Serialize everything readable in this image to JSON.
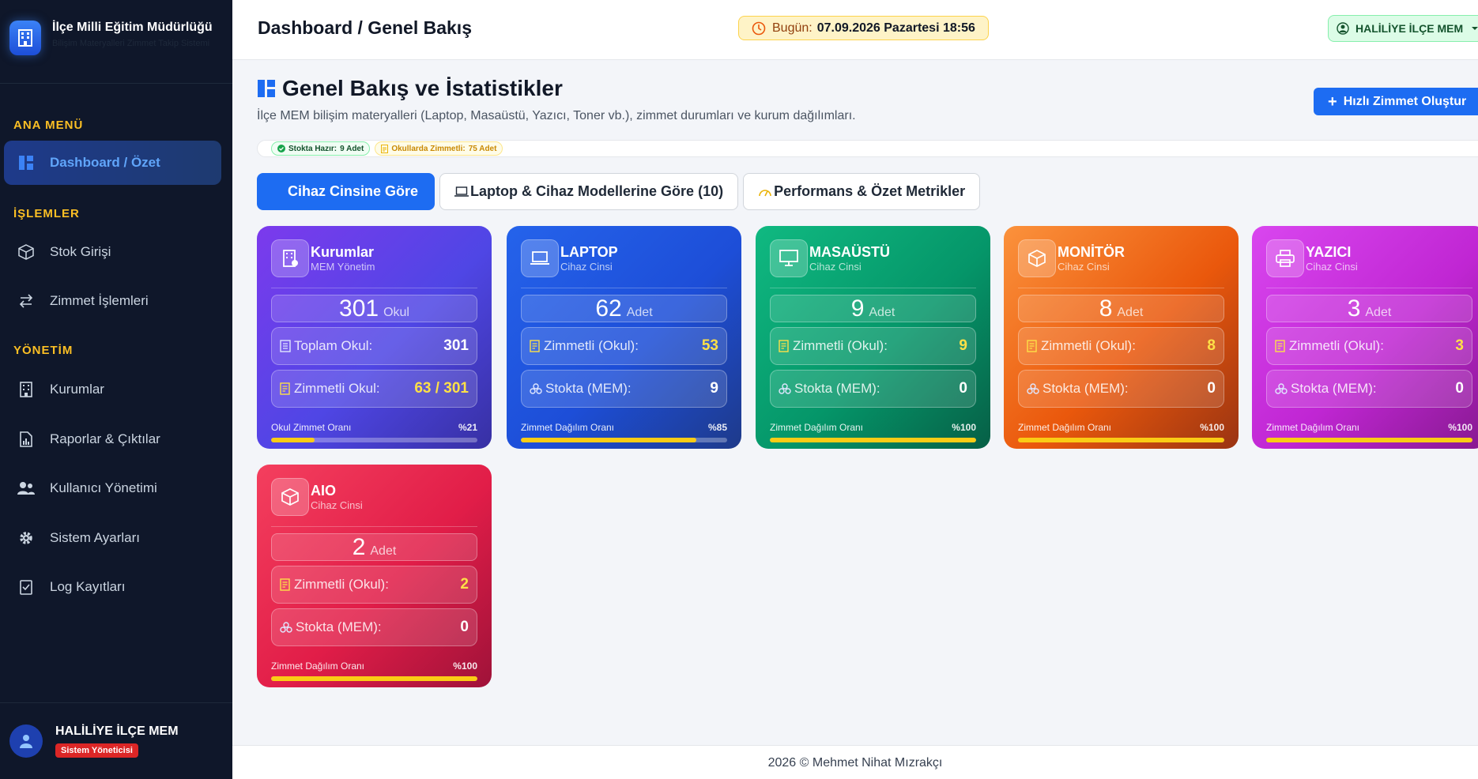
{
  "brand": {
    "title": "İlçe Milli Eğitim Müdürlüğü",
    "subtitle": "Bilişim Materyalleri Zimmet Takip Sistemi"
  },
  "sidebar": {
    "sections": [
      "ANA MENÜ",
      "İŞLEMLER",
      "YÖNETİM"
    ],
    "items": [
      {
        "label": "Dashboard / Özet",
        "icon": "dashboard-icon",
        "active": true
      },
      {
        "label": "Stok Girişi",
        "icon": "box-icon"
      },
      {
        "label": "Zimmet İşlemleri",
        "icon": "exchange-icon"
      },
      {
        "label": "Kurumlar",
        "icon": "building-icon"
      },
      {
        "label": "Raporlar & Çıktılar",
        "icon": "report-icon"
      },
      {
        "label": "Kullanıcı Yönetimi",
        "icon": "users-icon"
      },
      {
        "label": "Sistem Ayarları",
        "icon": "gear-icon"
      },
      {
        "label": "Log Kayıtları",
        "icon": "log-icon"
      }
    ],
    "user": {
      "name": "HALİLİYE İLÇE MEM",
      "role": "Sistem Yöneticisi"
    }
  },
  "topbar": {
    "title": "Dashboard / Genel Bakış",
    "date_label": "Bugün:",
    "date_value": "07.09.2026 Pazartesi 18:56",
    "unit": "HALİLİYE İLÇE MEM"
  },
  "page": {
    "title": "Genel Bakış ve İstatistikler",
    "description": "İlçe MEM bilişim materyalleri (Laptop, Masaüstü, Yazıcı, Toner vb.), zimmet durumları ve kurum dağılımları.",
    "quick_button": "Hızlı Zimmet Oluştur",
    "chips": {
      "stock_label": "Stokta Hazır:",
      "stock_value": "9 Adet",
      "assigned_label": "Okullarda Zimmetli:",
      "assigned_value": "75 Adet"
    },
    "tabs": [
      "Cihaz Cinsine Göre",
      "Laptop & Cihaz Modellerine Göre (10)",
      "Performans & Özet Metrikler"
    ]
  },
  "cards": [
    {
      "name": "Kurumlar",
      "sub": "MEM Yönetim",
      "count": "301",
      "unit": "Okul",
      "row1_label": "Toplam Okul:",
      "row1_value": "301",
      "row2_label": "Zimmetli Okul:",
      "row2_value": "63 / 301",
      "rate_label": "Okul Zimmet Oranı",
      "rate_value": "%21",
      "rate": 21
    },
    {
      "name": "LAPTOP",
      "sub": "Cihaz Cinsi",
      "count": "62",
      "unit": "Adet",
      "row1_label": "Zimmetli (Okul):",
      "row1_value": "53",
      "row2_label": "Stokta (MEM):",
      "row2_value": "9",
      "rate_label": "Zimmet Dağılım Oranı",
      "rate_value": "%85",
      "rate": 85
    },
    {
      "name": "MASAÜSTÜ",
      "sub": "Cihaz Cinsi",
      "count": "9",
      "unit": "Adet",
      "row1_label": "Zimmetli (Okul):",
      "row1_value": "9",
      "row2_label": "Stokta (MEM):",
      "row2_value": "0",
      "rate_label": "Zimmet Dağılım Oranı",
      "rate_value": "%100",
      "rate": 100
    },
    {
      "name": "MONİTÖR",
      "sub": "Cihaz Cinsi",
      "count": "8",
      "unit": "Adet",
      "row1_label": "Zimmetli (Okul):",
      "row1_value": "8",
      "row2_label": "Stokta (MEM):",
      "row2_value": "0",
      "rate_label": "Zimmet Dağılım Oranı",
      "rate_value": "%100",
      "rate": 100
    },
    {
      "name": "YAZICI",
      "sub": "Cihaz Cinsi",
      "count": "3",
      "unit": "Adet",
      "row1_label": "Zimmetli (Okul):",
      "row1_value": "3",
      "row2_label": "Stokta (MEM):",
      "row2_value": "0",
      "rate_label": "Zimmet Dağılım Oranı",
      "rate_value": "%100",
      "rate": 100
    },
    {
      "name": "AIO",
      "sub": "Cihaz Cinsi",
      "count": "2",
      "unit": "Adet",
      "row1_label": "Zimmetli (Okul):",
      "row1_value": "2",
      "row2_label": "Stokta (MEM):",
      "row2_value": "0",
      "rate_label": "Zimmet Dağılım Oranı",
      "rate_value": "%100",
      "rate": 100
    }
  ],
  "footer": "2026 © Mehmet Nihat Mızrakçı",
  "colors": {
    "primary": "#1d6cf2",
    "sidebar": "#0f172a",
    "accent": "#fbbf24"
  }
}
